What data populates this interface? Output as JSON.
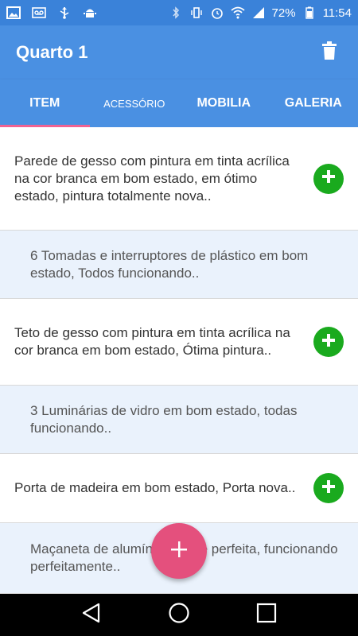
{
  "status_bar": {
    "battery": "72%",
    "time": "11:54"
  },
  "app_bar": {
    "title": "Quarto 1"
  },
  "tabs": [
    {
      "label": "ITEM"
    },
    {
      "label": "ACESSÓRIO"
    },
    {
      "label": "MOBILIA"
    },
    {
      "label": "GALERIA"
    }
  ],
  "list": [
    {
      "text": "Parede de gesso com pintura em tinta acrílica na cor branca em bom estado, em ótimo estado, pintura totalmente nova.."
    },
    {
      "text": "6 Tomadas e interruptores de plástico em bom estado, Todos funcionando.."
    },
    {
      "text": "Teto de gesso com pintura em tinta acrílica na cor branca em bom estado, Ótima pintura.."
    },
    {
      "text": "3 Luminárias de vidro em bom estado, todas funcionando.."
    },
    {
      "text": "Porta de madeira em bom estado, Porta nova.."
    },
    {
      "text": "Maçaneta de alumínio nova e perfeita, funcionando perfeitamente.."
    }
  ],
  "colors": {
    "primary": "#4a90e2",
    "status_bar": "#3a82d9",
    "accent": "#e4507d",
    "add_button": "#1aaa1e",
    "sub_row_bg": "#eaf2fc"
  },
  "icons": {
    "trash": "trash-icon",
    "add": "plus-circle-icon",
    "fab": "plus-icon"
  }
}
